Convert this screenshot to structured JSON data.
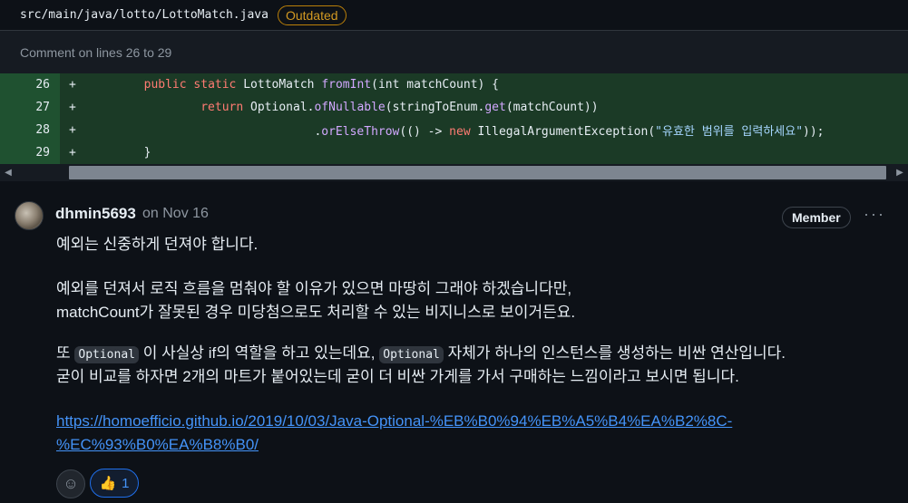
{
  "file": {
    "path": "src/main/java/lotto/LottoMatch.java",
    "status_badge": "Outdated"
  },
  "comment_range": "Comment on lines 26 to 29",
  "code_lines": [
    {
      "number": "26",
      "sign": "+"
    },
    {
      "number": "27",
      "sign": "+"
    },
    {
      "number": "28",
      "sign": "+"
    },
    {
      "number": "29",
      "sign": "+"
    }
  ],
  "code_text": {
    "line26": {
      "kw1": "public",
      "kw2": "static",
      "type": "LottoMatch",
      "fn": "fromInt",
      "rest": "(int matchCount) {"
    },
    "line27": {
      "kw": "return",
      "type": "Optional.",
      "fn1": "ofNullable",
      "mid": "(stringToEnum.",
      "fn2": "get",
      "end": "(matchCount))"
    },
    "line28": {
      "dot": ".",
      "fn": "orElseThrow",
      "mid": "(() -> ",
      "kw": "new",
      "type": " IllegalArgumentException(",
      "str": "\"유효한 범위를 입력하세요\"",
      "end": "));"
    },
    "line29": {
      "text": "}"
    }
  },
  "comment": {
    "author": "dhmin5693",
    "date": "on Nov 16",
    "role_badge": "Member",
    "more_label": "···",
    "paragraph1": "예외는 신중하게 던져야 합니다.",
    "paragraph2_line1": "예외를 던져서 로직 흐름을 멈춰야 할 이유가 있으면 마땅히 그래야 하겠습니다만,",
    "paragraph2_line2": "matchCount가 잘못된 경우 미당첨으로도 처리할 수 있는 비지니스로 보이거든요.",
    "paragraph3": {
      "part1": "또 ",
      "code1": "Optional",
      "part2": " 이 사실상 if의 역할을 하고 있는데요, ",
      "code2": "Optional",
      "part3": " 자체가 하나의 인스턴스를 생성하는 비싼 연산입니다."
    },
    "paragraph3_line2": "굳이 비교를 하자면 2개의 마트가 붙어있는데 굳이 더 비싼 가게를 가서 구매하는 느낌이라고 보시면 됩니다.",
    "link": "https://homoefficio.github.io/2019/10/03/Java-Optional-%EB%B0%94%EB%A5%B4%EA%B2%8C-%EC%93%B0%EA%B8%B0/",
    "reactions": [
      {
        "emoji": "👍",
        "count": "1"
      }
    ]
  },
  "colors": {
    "badge_outdated": "#d29922",
    "added_line_bg": "#1b3a26",
    "link": "#4493f8",
    "keyword": "#ff7b72",
    "function": "#d2a8ff",
    "string": "#a5d6ff"
  },
  "icons": [
    "smiley-icon",
    "thumbs-up-icon",
    "kebab-icon",
    "scroll-left-icon",
    "scroll-right-icon"
  ]
}
